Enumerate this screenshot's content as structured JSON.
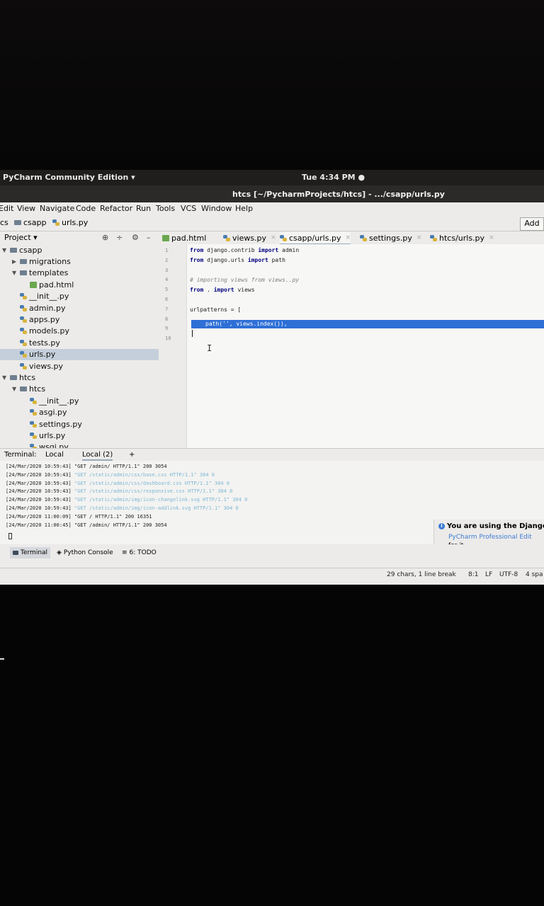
{
  "system": {
    "app_menu": "PyCharm Community Edition ▾",
    "clock": "Tue  4:34 PM ●"
  },
  "window": {
    "title": "htcs [~/PycharmProjects/htcs] - .../csapp/urls.py"
  },
  "menu": [
    "Edit",
    "View",
    "Navigate",
    "Code",
    "Refactor",
    "Run",
    "Tools",
    "VCS",
    "Window",
    "Help"
  ],
  "breadcrumbs": [
    "cs",
    "csapp",
    "urls.py"
  ],
  "add_button": "Add",
  "project": {
    "label": "Project ▾"
  },
  "tree": [
    {
      "label": "csapp",
      "kind": "folder",
      "indent": 0,
      "arrow": "▼"
    },
    {
      "label": "migrations",
      "kind": "folder",
      "indent": 1,
      "arrow": "▶"
    },
    {
      "label": "templates",
      "kind": "folder",
      "indent": 1,
      "arrow": "▼"
    },
    {
      "label": "pad.html",
      "kind": "html",
      "indent": 2,
      "arrow": ""
    },
    {
      "label": "__init__.py",
      "kind": "py",
      "indent": 1,
      "arrow": ""
    },
    {
      "label": "admin.py",
      "kind": "py",
      "indent": 1,
      "arrow": ""
    },
    {
      "label": "apps.py",
      "kind": "py",
      "indent": 1,
      "arrow": ""
    },
    {
      "label": "models.py",
      "kind": "py",
      "indent": 1,
      "arrow": ""
    },
    {
      "label": "tests.py",
      "kind": "py",
      "indent": 1,
      "arrow": ""
    },
    {
      "label": "urls.py",
      "kind": "py",
      "indent": 1,
      "arrow": "",
      "selected": true
    },
    {
      "label": "views.py",
      "kind": "py",
      "indent": 1,
      "arrow": ""
    },
    {
      "label": "htcs",
      "kind": "folder",
      "indent": 0,
      "arrow": "▼"
    },
    {
      "label": "htcs",
      "kind": "folder",
      "indent": 1,
      "arrow": "▼"
    },
    {
      "label": "__init__.py",
      "kind": "py",
      "indent": 2,
      "arrow": ""
    },
    {
      "label": "asgi.py",
      "kind": "py",
      "indent": 2,
      "arrow": ""
    },
    {
      "label": "settings.py",
      "kind": "py",
      "indent": 2,
      "arrow": ""
    },
    {
      "label": "urls.py",
      "kind": "py",
      "indent": 2,
      "arrow": ""
    },
    {
      "label": "wsgi.py",
      "kind": "py",
      "indent": 2,
      "arrow": ""
    }
  ],
  "tabs": [
    {
      "label": "pad.html",
      "kind": "html",
      "closable": false
    },
    {
      "label": "views.py",
      "kind": "py",
      "closable": true
    },
    {
      "label": "csapp/urls.py",
      "kind": "py",
      "closable": true,
      "active": true
    },
    {
      "label": "settings.py",
      "kind": "py",
      "closable": true
    },
    {
      "label": "htcs/urls.py",
      "kind": "py",
      "closable": true
    }
  ],
  "line_numbers": [
    "1",
    "2",
    "3",
    "4",
    "5",
    "6",
    "7",
    "8",
    "9",
    "10"
  ],
  "code": {
    "l1_kw": "from",
    "l1_rest": " django.contrib ",
    "l1_kw2": "import",
    "l1_end": " admin",
    "l2_kw": "from",
    "l2_rest": " django.urls ",
    "l2_kw2": "import",
    "l2_end": " path",
    "l4": "# importing views from views..py",
    "l5_kw": "from",
    "l5_rest": " . ",
    "l5_kw2": "import",
    "l5_end": " views",
    "l7": "urlpatterns = [",
    "l8": "path('', views.index()),"
  },
  "terminal": {
    "label": "Terminal:",
    "tabs": [
      "Local",
      "Local (2)",
      "+"
    ],
    "lines": [
      {
        "ts": "[24/Mar/2020 10:59:43]",
        "msg": " \"GET /admin/ HTTP/1.1\" 200 3054",
        "faint": false
      },
      {
        "ts": "[24/Mar/2020 10:59:43]",
        "msg": " \"GET /static/admin/css/base.css HTTP/1.1\" 304 0",
        "faint": true
      },
      {
        "ts": "[24/Mar/2020 10:59:43]",
        "msg": " \"GET /static/admin/css/dashboard.css HTTP/1.1\" 304 0",
        "faint": true
      },
      {
        "ts": "[24/Mar/2020 10:59:43]",
        "msg": " \"GET /static/admin/css/responsive.css HTTP/1.1\" 304 0",
        "faint": true
      },
      {
        "ts": "[24/Mar/2020 10:59:43]",
        "msg": " \"GET /static/admin/img/icon-changelink.svg HTTP/1.1\" 304 0",
        "faint": true
      },
      {
        "ts": "[24/Mar/2020 10:59:43]",
        "msg": " \"GET /static/admin/img/icon-addlink.svg HTTP/1.1\" 304 0",
        "faint": true
      },
      {
        "ts": "[24/Mar/2020 11:00:09]",
        "msg": " \"GET / HTTP/1.1\" 200 16351",
        "faint": false
      },
      {
        "ts": "[24/Mar/2020 11:00:45]",
        "msg": " \"GET /admin/ HTTP/1.1\" 200 3054",
        "faint": false
      }
    ]
  },
  "notification": {
    "title": "You are using the Django",
    "link": "PyCharm Professional Edit",
    "tail": "for it."
  },
  "toolwindows": [
    "Terminal",
    "Python Console",
    "6: TODO"
  ],
  "status": {
    "chars": "29 chars, 1 line break",
    "pos": "8:1",
    "lf": "LF",
    "enc": "UTF-8",
    "indent": "4 spa"
  },
  "colors": {
    "selection": "#2e6fd6",
    "keyword": "#000080",
    "link": "#3d7bd4"
  }
}
